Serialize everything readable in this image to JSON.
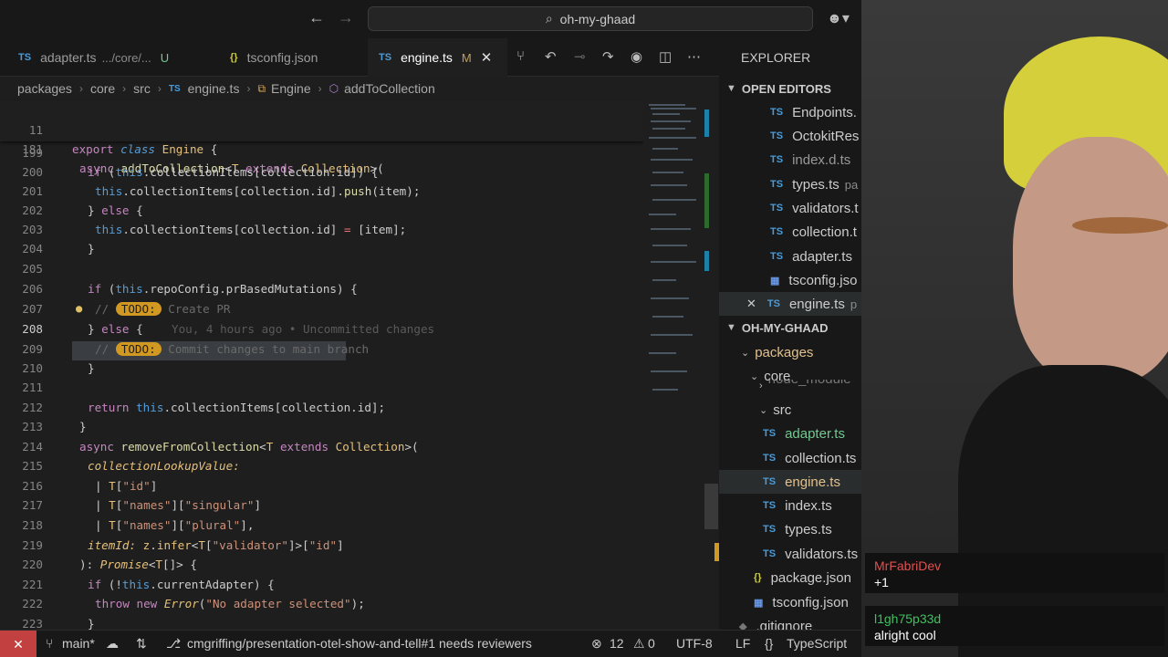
{
  "titlebar": {
    "back_icon": "arrow-left-icon",
    "forward_icon": "arrow-right-icon",
    "search_text": "oh-my-ghaad"
  },
  "tabs": [
    {
      "label": "adapter.ts",
      "desc": ".../core/...",
      "flag": "U",
      "active": false
    },
    {
      "label": "tsconfig.json",
      "active": false
    },
    {
      "label": "engine.ts",
      "flag": "M",
      "active": true
    }
  ],
  "breadcrumb": [
    "packages",
    "core",
    "src",
    "engine.ts",
    "Engine",
    "addToCollection"
  ],
  "editor": {
    "sticky": [
      {
        "n": "11",
        "code": "export class Engine {"
      },
      {
        "n": "181",
        "code": "async addToCollection<T extends Collection>("
      }
    ],
    "lines": [
      {
        "n": "199",
        "code": ""
      },
      {
        "n": "200",
        "code": "if (this.collectionItems[collection.id]) {"
      },
      {
        "n": "201",
        "code": "this.collectionItems[collection.id].push(item);"
      },
      {
        "n": "202",
        "code": "} else {"
      },
      {
        "n": "203",
        "code": "this.collectionItems[collection.id] = [item];"
      },
      {
        "n": "204",
        "code": "}"
      },
      {
        "n": "205",
        "code": ""
      },
      {
        "n": "206",
        "code": "if (this.repoConfig.prBasedMutations) {"
      },
      {
        "n": "207",
        "code": "// TODO: Create PR"
      },
      {
        "n": "208",
        "code": "} else {"
      },
      {
        "n": "209",
        "code": "// TODO: Commit changes to main branch"
      },
      {
        "n": "210",
        "code": "}"
      },
      {
        "n": "211",
        "code": ""
      },
      {
        "n": "212",
        "code": "return this.collectionItems[collection.id];"
      },
      {
        "n": "213",
        "code": "}"
      },
      {
        "n": "214",
        "code": "async removeFromCollection<T extends Collection>("
      },
      {
        "n": "215",
        "code": "collectionLookupValue:"
      },
      {
        "n": "216",
        "code": "| T[\"id\"]"
      },
      {
        "n": "217",
        "code": "| T[\"names\"][\"singular\"]"
      },
      {
        "n": "218",
        "code": "| T[\"names\"][\"plural\"],"
      },
      {
        "n": "219",
        "code": "itemId: z.infer<T[\"validator\"]>[\"id\"]"
      },
      {
        "n": "220",
        "code": "): Promise<T[]> {"
      },
      {
        "n": "221",
        "code": "if (!this.currentAdapter) {"
      },
      {
        "n": "222",
        "code": "throw new Error(\"No adapter selected\");"
      },
      {
        "n": "223",
        "code": "}"
      }
    ],
    "blame": "You, 4 hours ago • Uncommitted changes"
  },
  "explorer": {
    "title": "EXPLORER",
    "open_editors_label": "OPEN EDITORS",
    "open_editors": [
      {
        "name": "Endpoints.",
        "kind": "ts"
      },
      {
        "name": "OctokitRes",
        "kind": "ts"
      },
      {
        "name": "index.d.ts",
        "kind": "ts"
      },
      {
        "name": "types.ts",
        "hint": "pa",
        "kind": "ts"
      },
      {
        "name": "validators.t",
        "kind": "ts"
      },
      {
        "name": "collection.t",
        "kind": "ts"
      },
      {
        "name": "adapter.ts",
        "kind": "ts"
      },
      {
        "name": "tsconfig.jso",
        "kind": "json"
      },
      {
        "name": "engine.ts",
        "hint": "p",
        "kind": "ts"
      }
    ],
    "workspace_label": "OH-MY-GHAAD",
    "tree": [
      {
        "name": "packages",
        "kind": "folder"
      },
      {
        "name": "core",
        "kind": "folder"
      },
      {
        "name": "node_module",
        "kind": "partial"
      },
      {
        "name": "src",
        "kind": "folder"
      },
      {
        "name": "adapter.ts",
        "kind": "ts"
      },
      {
        "name": "collection.ts",
        "kind": "ts"
      },
      {
        "name": "engine.ts",
        "kind": "ts"
      },
      {
        "name": "index.ts",
        "kind": "ts"
      },
      {
        "name": "types.ts",
        "kind": "ts"
      },
      {
        "name": "validators.ts",
        "kind": "ts"
      },
      {
        "name": "package.json",
        "kind": "json"
      },
      {
        "name": "tsconfig.json",
        "kind": "json"
      },
      {
        "name": ".gitignore",
        "kind": "file"
      }
    ]
  },
  "chat": [
    {
      "user": "MrFabriDev",
      "msg": "+1",
      "color": "#e05050"
    },
    {
      "user": "l1gh75p33d",
      "msg": "alright cool",
      "color": "#40c060"
    }
  ],
  "status": {
    "branch": "main*",
    "pr": "cmgriffing/presentation-otel-show-and-tell#1 needs reviewers",
    "problems": "12",
    "warnings": "0",
    "encoding": "UTF-8",
    "eol": "LF",
    "language": "TypeScript"
  },
  "colors": {
    "accent_remote": "#c24040",
    "todo_badge": "#d29922",
    "ts_icon": "#4d9bd6"
  }
}
